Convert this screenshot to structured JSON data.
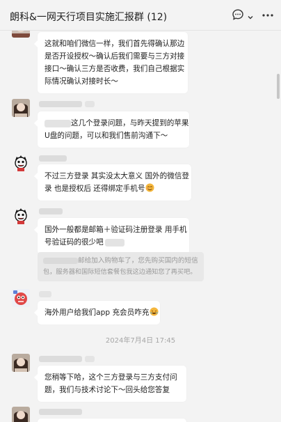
{
  "header": {
    "title": "朗科&一网天行项目实施汇报群 (12)",
    "icons": [
      "chat-bubble-icon",
      "chevron-down-icon",
      "more-icon"
    ]
  },
  "messages": [
    {
      "lines": [
        "这就和咱们微信一样，我们首先得确认那边",
        "是否开设授权～确认后我们需要与三方对接",
        "接口～确认三方是否收费，我们自己根据实",
        "际情况确认对接时长～"
      ]
    },
    {
      "lines": [
        "这几个登录问题，与昨天提到的苹果",
        "U盘的问题，可以和我们售前沟通下～"
      ]
    },
    {
      "lines": [
        "不过三方登录 其实没太大意义 国外的微信登",
        "录 也是授权后 还得绑定手机号"
      ]
    },
    {
      "lines": [
        "国外一般都是邮箱＋验证码注册登录 用手机",
        "号验证码的很少吧"
      ]
    },
    {
      "quote_lines": [
        "邮给加入购物车了，您先购买国内的短信",
        "包，服务器和国际短信套餐包我这边通知您了再买吧。"
      ]
    },
    {
      "lines": [
        "海外用户给我们app 充会员咋充"
      ]
    },
    {
      "lines": [
        "您稍等下哈，这个三方登录与三方支付问",
        "题，我们与技术讨论下～回头给您答复"
      ]
    }
  ],
  "timestamp": "2024年7月4日 17:45",
  "colors": {
    "background": "#f3f3f3",
    "bubble": "#ffffff",
    "quote_bg": "#e8e8e8",
    "emoji": "#f4b63c"
  }
}
